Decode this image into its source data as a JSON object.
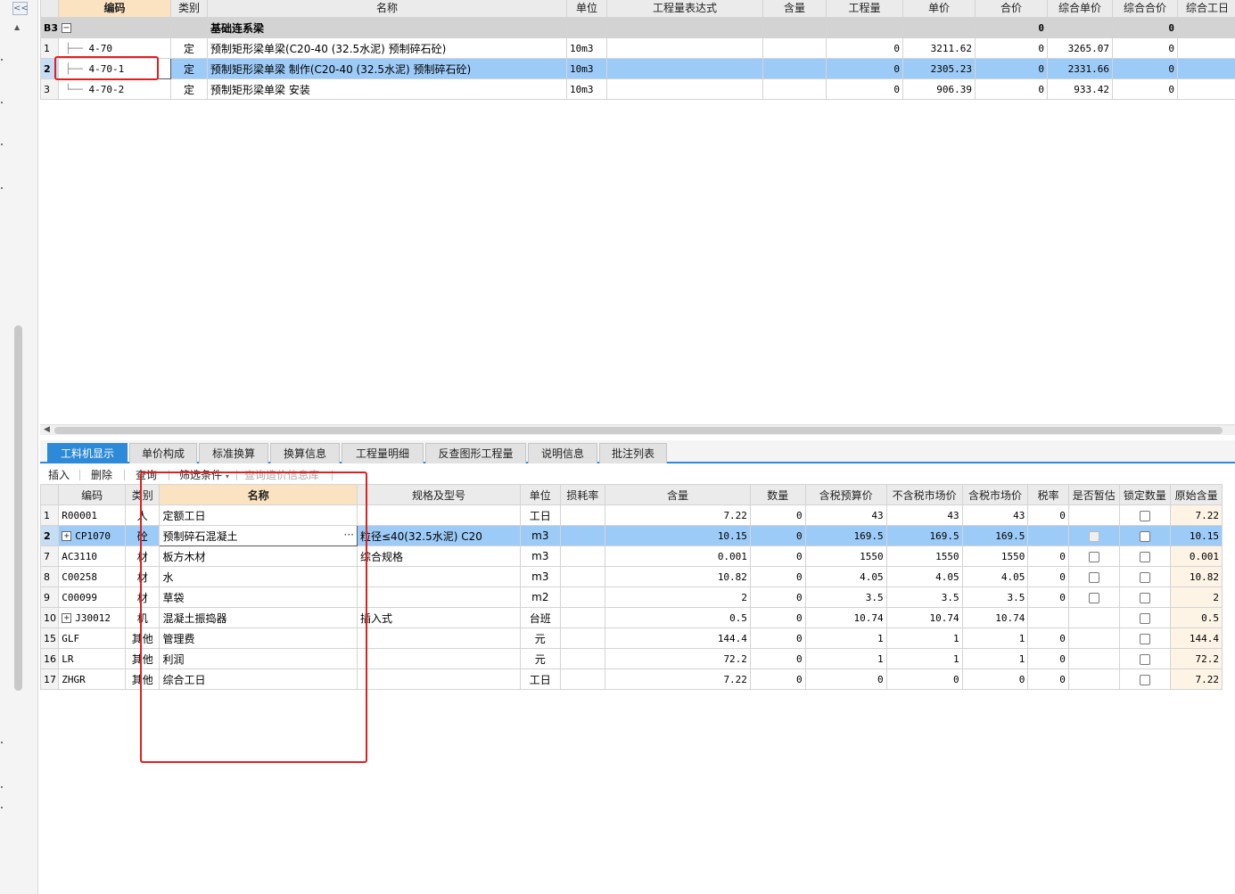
{
  "left_panel": {
    "collapse_glyph": "<<",
    "up_glyph": "▲"
  },
  "upper_table": {
    "headers": [
      "编码",
      "类别",
      "名称",
      "单位",
      "工程量表达式",
      "含量",
      "工程量",
      "单价",
      "合价",
      "综合单价",
      "综合合价",
      "综合工日"
    ],
    "group": {
      "rownum": "B3",
      "toggle": "−",
      "name": "基础连系梁",
      "total": "0",
      "total2": "0"
    },
    "rows": [
      {
        "rownum": "1",
        "code": "4-70",
        "type": "定",
        "name": "预制矩形梁单梁(C20-40 (32.5水泥) 预制碎石砼)",
        "unit": "10m3",
        "expr": "",
        "content": "",
        "qty": "0",
        "price": "3211.62",
        "amount": "0",
        "comp_price": "3265.07",
        "comp_amount": "0"
      },
      {
        "rownum": "2",
        "code": "4-70-1",
        "type": "定",
        "name": "预制矩形梁单梁 制作(C20-40 (32.5水泥) 预制碎石砼)",
        "unit": "10m3",
        "expr": "",
        "content": "",
        "qty": "0",
        "price": "2305.23",
        "amount": "0",
        "comp_price": "2331.66",
        "comp_amount": "0"
      },
      {
        "rownum": "3",
        "code": "4-70-2",
        "type": "定",
        "name": "预制矩形梁单梁 安装",
        "unit": "10m3",
        "expr": "",
        "content": "",
        "qty": "0",
        "price": "906.39",
        "amount": "0",
        "comp_price": "933.42",
        "comp_amount": "0"
      }
    ]
  },
  "tabs": [
    "工料机显示",
    "单价构成",
    "标准换算",
    "换算信息",
    "工程量明细",
    "反查图形工程量",
    "说明信息",
    "批注列表"
  ],
  "toolbar": {
    "insert": "插入",
    "delete": "删除",
    "query": "查询",
    "filter": "筛选条件",
    "filter_arrow": "▾",
    "price_db": "查询造价信息库"
  },
  "lower_table": {
    "headers": [
      "编码",
      "类别",
      "名称",
      "规格及型号",
      "单位",
      "损耗率",
      "含量",
      "数量",
      "含税预算价",
      "不含税市场价",
      "含税市场价",
      "税率",
      "是否暂估",
      "锁定数量",
      "原始含量"
    ],
    "rows": [
      {
        "rownum": "1",
        "expand": "",
        "code": "R00001",
        "type": "人",
        "name": "定额工日",
        "spec": "",
        "unit": "工日",
        "loss": "",
        "content": "7.22",
        "qty": "0",
        "tax_budget": "43",
        "notax_market": "43",
        "tax_market": "43",
        "tax_rate": "0",
        "provisional": "none",
        "locked": "box",
        "orig": "7.22"
      },
      {
        "rownum": "2",
        "expand": "+",
        "code": "CP1070",
        "type": "砼",
        "name": "预制碎石混凝土",
        "spec": "粒径≤40(32.5水泥) C20",
        "unit": "m3",
        "loss": "",
        "content": "10.15",
        "qty": "0",
        "tax_budget": "169.5",
        "notax_market": "169.5",
        "tax_market": "169.5",
        "tax_rate": "",
        "provisional": "disabled",
        "locked": "box",
        "orig": "10.15"
      },
      {
        "rownum": "7",
        "expand": "",
        "code": "AC3110",
        "type": "材",
        "name": "板方木材",
        "spec": "综合规格",
        "unit": "m3",
        "loss": "",
        "content": "0.001",
        "qty": "0",
        "tax_budget": "1550",
        "notax_market": "1550",
        "tax_market": "1550",
        "tax_rate": "0",
        "provisional": "box",
        "locked": "box",
        "orig": "0.001"
      },
      {
        "rownum": "8",
        "expand": "",
        "code": "C00258",
        "type": "材",
        "name": "水",
        "spec": "",
        "unit": "m3",
        "loss": "",
        "content": "10.82",
        "qty": "0",
        "tax_budget": "4.05",
        "notax_market": "4.05",
        "tax_market": "4.05",
        "tax_rate": "0",
        "provisional": "box",
        "locked": "box",
        "orig": "10.82"
      },
      {
        "rownum": "9",
        "expand": "",
        "code": "C00099",
        "type": "材",
        "name": "草袋",
        "spec": "",
        "unit": "m2",
        "loss": "",
        "content": "2",
        "qty": "0",
        "tax_budget": "3.5",
        "notax_market": "3.5",
        "tax_market": "3.5",
        "tax_rate": "0",
        "provisional": "box",
        "locked": "box",
        "orig": "2"
      },
      {
        "rownum": "10",
        "expand": "+",
        "code": "J30012",
        "type": "机",
        "name": "混凝土振捣器",
        "spec": "插入式",
        "unit": "台班",
        "loss": "",
        "content": "0.5",
        "qty": "0",
        "tax_budget": "10.74",
        "notax_market": "10.74",
        "tax_market": "10.74",
        "tax_rate": "",
        "provisional": "none",
        "locked": "box",
        "orig": "0.5"
      },
      {
        "rownum": "15",
        "expand": "",
        "code": "GLF",
        "type": "其他",
        "name": "管理费",
        "spec": "",
        "unit": "元",
        "loss": "",
        "content": "144.4",
        "qty": "0",
        "tax_budget": "1",
        "notax_market": "1",
        "tax_market": "1",
        "tax_rate": "0",
        "provisional": "none",
        "locked": "box",
        "orig": "144.4"
      },
      {
        "rownum": "16",
        "expand": "",
        "code": "LR",
        "type": "其他",
        "name": "利润",
        "spec": "",
        "unit": "元",
        "loss": "",
        "content": "72.2",
        "qty": "0",
        "tax_budget": "1",
        "notax_market": "1",
        "tax_market": "1",
        "tax_rate": "0",
        "provisional": "none",
        "locked": "box",
        "orig": "72.2"
      },
      {
        "rownum": "17",
        "expand": "",
        "code": "ZHGR",
        "type": "其他",
        "name": "综合工日",
        "spec": "",
        "unit": "工日",
        "loss": "",
        "content": "7.22",
        "qty": "0",
        "tax_budget": "0",
        "notax_market": "0",
        "tax_market": "0",
        "tax_rate": "0",
        "provisional": "none",
        "locked": "box",
        "orig": "7.22"
      }
    ]
  },
  "colors": {
    "selection": "#9dcbf7",
    "accent": "#2d8ad8",
    "annotation": "#e02020",
    "active_header": "#fbe3c1"
  }
}
